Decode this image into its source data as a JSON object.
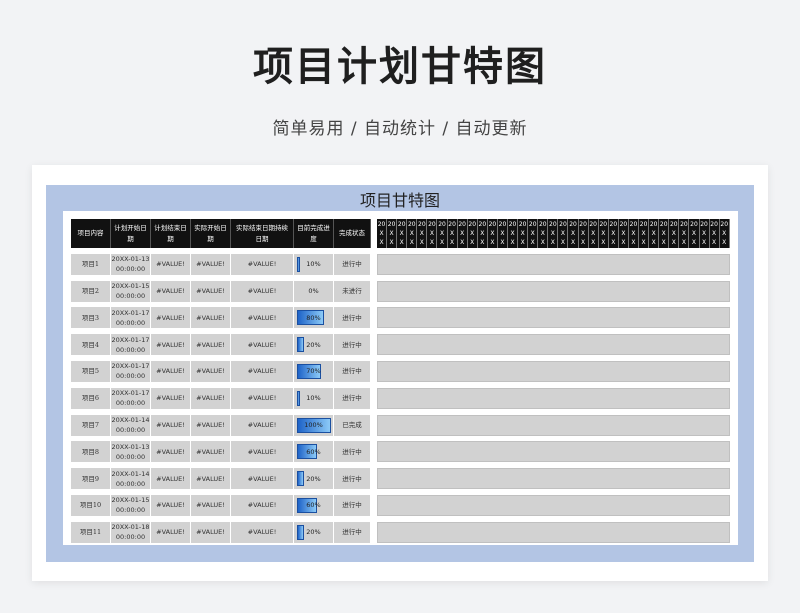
{
  "header": {
    "title": "项目计划甘特图",
    "subtitle": "简单易用 / 自动统计 / 自动更新"
  },
  "sheet": {
    "title": "项目甘特图",
    "columns": [
      "项目内容",
      "计划开始日期",
      "计划结束日期",
      "实际开始日期",
      "实际结束日期持续日期",
      "目前完成进度",
      "完成状态"
    ],
    "rows": [
      {
        "name": "项目1",
        "start_date": "20XX-01-13",
        "start_time": "00:00:00",
        "plan_end": "#VALUE!",
        "actual_start": "#VALUE!",
        "actual_end": "#VALUE!",
        "progress": 0.1,
        "progress_label": "10%",
        "status": "进行中"
      },
      {
        "name": "项目2",
        "start_date": "20XX-01-15",
        "start_time": "00:00:00",
        "plan_end": "#VALUE!",
        "actual_start": "#VALUE!",
        "actual_end": "#VALUE!",
        "progress": 0.0,
        "progress_label": "0%",
        "status": "未进行"
      },
      {
        "name": "项目3",
        "start_date": "20XX-01-17",
        "start_time": "00:00:00",
        "plan_end": "#VALUE!",
        "actual_start": "#VALUE!",
        "actual_end": "#VALUE!",
        "progress": 0.8,
        "progress_label": "80%",
        "status": "进行中"
      },
      {
        "name": "项目4",
        "start_date": "20XX-01-17",
        "start_time": "00:00:00",
        "plan_end": "#VALUE!",
        "actual_start": "#VALUE!",
        "actual_end": "#VALUE!",
        "progress": 0.2,
        "progress_label": "20%",
        "status": "进行中"
      },
      {
        "name": "项目5",
        "start_date": "20XX-01-17",
        "start_time": "00:00:00",
        "plan_end": "#VALUE!",
        "actual_start": "#VALUE!",
        "actual_end": "#VALUE!",
        "progress": 0.7,
        "progress_label": "70%",
        "status": "进行中"
      },
      {
        "name": "项目6",
        "start_date": "20XX-01-17",
        "start_time": "00:00:00",
        "plan_end": "#VALUE!",
        "actual_start": "#VALUE!",
        "actual_end": "#VALUE!",
        "progress": 0.1,
        "progress_label": "10%",
        "status": "进行中"
      },
      {
        "name": "项目7",
        "start_date": "20XX-01-14",
        "start_time": "00:00:00",
        "plan_end": "#VALUE!",
        "actual_start": "#VALUE!",
        "actual_end": "#VALUE!",
        "progress": 1.0,
        "progress_label": "100%",
        "status": "已完成"
      },
      {
        "name": "项目8",
        "start_date": "20XX-01-13",
        "start_time": "00:00:00",
        "plan_end": "#VALUE!",
        "actual_start": "#VALUE!",
        "actual_end": "#VALUE!",
        "progress": 0.6,
        "progress_label": "60%",
        "status": "进行中"
      },
      {
        "name": "项目9",
        "start_date": "20XX-01-14",
        "start_time": "00:00:00",
        "plan_end": "#VALUE!",
        "actual_start": "#VALUE!",
        "actual_end": "#VALUE!",
        "progress": 0.2,
        "progress_label": "20%",
        "status": "进行中"
      },
      {
        "name": "项目10",
        "start_date": "20XX-01-15",
        "start_time": "00:00:00",
        "plan_end": "#VALUE!",
        "actual_start": "#VALUE!",
        "actual_end": "#VALUE!",
        "progress": 0.6,
        "progress_label": "60%",
        "status": "进行中"
      },
      {
        "name": "项目11",
        "start_date": "20XX-01-18",
        "start_time": "00:00:00",
        "plan_end": "#VALUE!",
        "actual_start": "#VALUE!",
        "actual_end": "#VALUE!",
        "progress": 0.2,
        "progress_label": "20%",
        "status": "进行中"
      }
    ],
    "gantt_header": {
      "year": "20",
      "month": "X",
      "day": "X"
    },
    "gantt_column_count": 35,
    "progress_color": "#1e63c8"
  }
}
